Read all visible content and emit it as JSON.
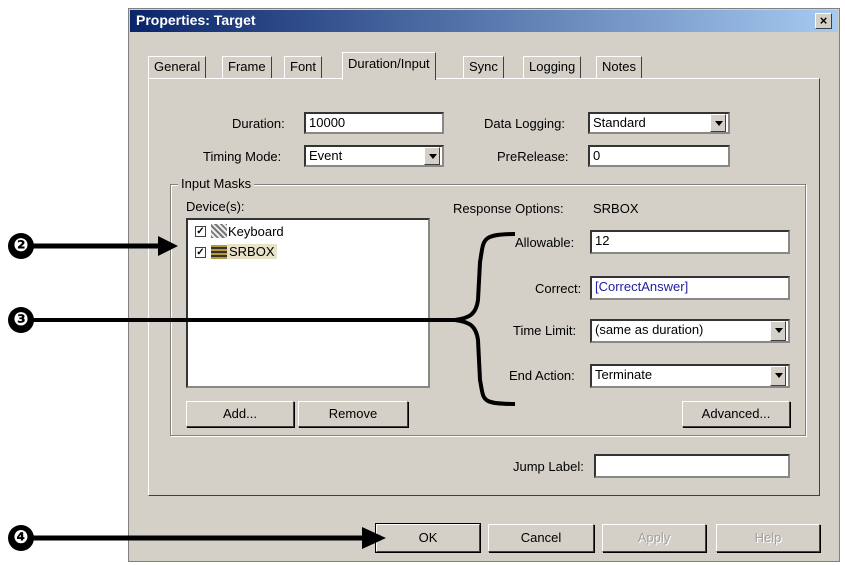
{
  "dialog": {
    "title": "Properties: Target",
    "close_glyph": "×"
  },
  "tabs": [
    {
      "label": "General"
    },
    {
      "label": "Frame"
    },
    {
      "label": "Font"
    },
    {
      "label": "Duration/Input",
      "active": true
    },
    {
      "label": "Sync"
    },
    {
      "label": "Logging"
    },
    {
      "label": "Notes"
    }
  ],
  "fields": {
    "duration": {
      "label": "Duration:",
      "value": "10000"
    },
    "timing_mode": {
      "label": "Timing Mode:",
      "value": "Event"
    },
    "data_logging": {
      "label": "Data Logging:",
      "value": "Standard"
    },
    "prerelease": {
      "label": "PreRelease:",
      "value": "0"
    }
  },
  "input_masks": {
    "group_label": "Input Masks",
    "devices_label": "Device(s):",
    "devices": [
      {
        "name": "Keyboard",
        "checked": true,
        "icon": "keyboard-icon"
      },
      {
        "name": "SRBOX",
        "checked": true,
        "selected": true,
        "icon": "srbox-icon"
      }
    ],
    "response_options_label": "Response Options:",
    "response_options_device": "SRBOX",
    "allowable": {
      "label": "Allowable:",
      "value": "12"
    },
    "correct": {
      "label": "Correct:",
      "value": "[CorrectAnswer]"
    },
    "time_limit": {
      "label": "Time Limit:",
      "value": "(same as duration)"
    },
    "end_action": {
      "label": "End Action:",
      "value": "Terminate"
    },
    "add_button": "Add...",
    "remove_button": "Remove",
    "advanced_button": "Advanced..."
  },
  "jump_label": {
    "label": "Jump Label:",
    "value": ""
  },
  "buttons": {
    "ok": "OK",
    "cancel": "Cancel",
    "apply": "Apply",
    "help": "Help"
  },
  "annotations": {
    "two": "❷",
    "three": "❸",
    "four": "❹"
  },
  "colors": {
    "title_bar": "#0a246a",
    "dialog_bg": "#d4d0c8",
    "correct_text": "#1e1ea0"
  }
}
